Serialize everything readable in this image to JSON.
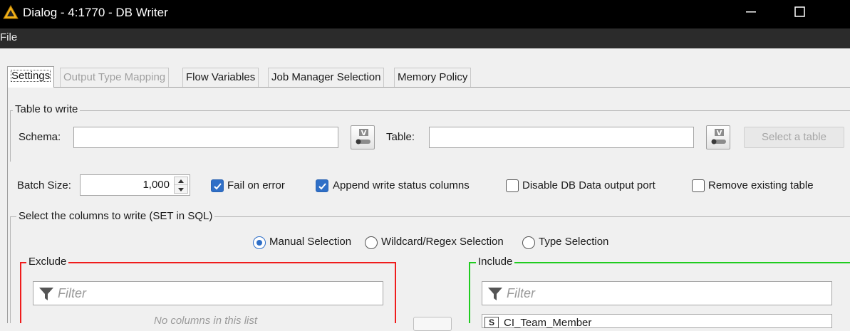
{
  "window": {
    "title": "Dialog - 4:1770 - DB Writer",
    "icons": [
      "warning-triangle-icon",
      "minimize-icon",
      "maximize-icon"
    ]
  },
  "menu": {
    "file": "File"
  },
  "tabs": [
    {
      "label": "Settings",
      "state": "active"
    },
    {
      "label": "Output Type Mapping",
      "state": "disabled"
    },
    {
      "label": "Flow Variables",
      "state": "normal"
    },
    {
      "label": "Job Manager Selection",
      "state": "normal"
    },
    {
      "label": "Memory Policy",
      "state": "normal"
    }
  ],
  "table_to_write": {
    "group_label": "Table to write",
    "schema_label": "Schema:",
    "schema_value": "",
    "table_label": "Table:",
    "table_value": "",
    "select_table_button": "Select a table",
    "flow_variable_button_icon": "flow-variable-icon"
  },
  "options": {
    "batch_size_label": "Batch Size:",
    "batch_size_value": "1,000",
    "fail_on_error": {
      "label": "Fail on error",
      "checked": true
    },
    "append_status": {
      "label": "Append write status columns",
      "checked": true
    },
    "disable_output": {
      "label": "Disable DB Data output port",
      "checked": false
    },
    "remove_table": {
      "label": "Remove existing table",
      "checked": false
    }
  },
  "columns": {
    "group_label": "Select the columns to write (SET in SQL)",
    "modes": [
      {
        "label": "Manual Selection",
        "selected": true
      },
      {
        "label": "Wildcard/Regex Selection",
        "selected": false
      },
      {
        "label": "Type Selection",
        "selected": false
      }
    ],
    "exclude": {
      "label": "Exclude",
      "filter_placeholder": "Filter",
      "empty_text": "No columns in this list"
    },
    "include": {
      "label": "Include",
      "filter_placeholder": "Filter",
      "items": [
        {
          "type": "S",
          "name": "CI_Team_Member"
        }
      ]
    },
    "colors": {
      "exclude_border": "#ef1c1c",
      "include_border": "#1fcc1f"
    }
  },
  "colors": {
    "checkbox_accent": "#2f6fc7",
    "titlebar": "#000000",
    "menubar": "#2b2b2b"
  }
}
